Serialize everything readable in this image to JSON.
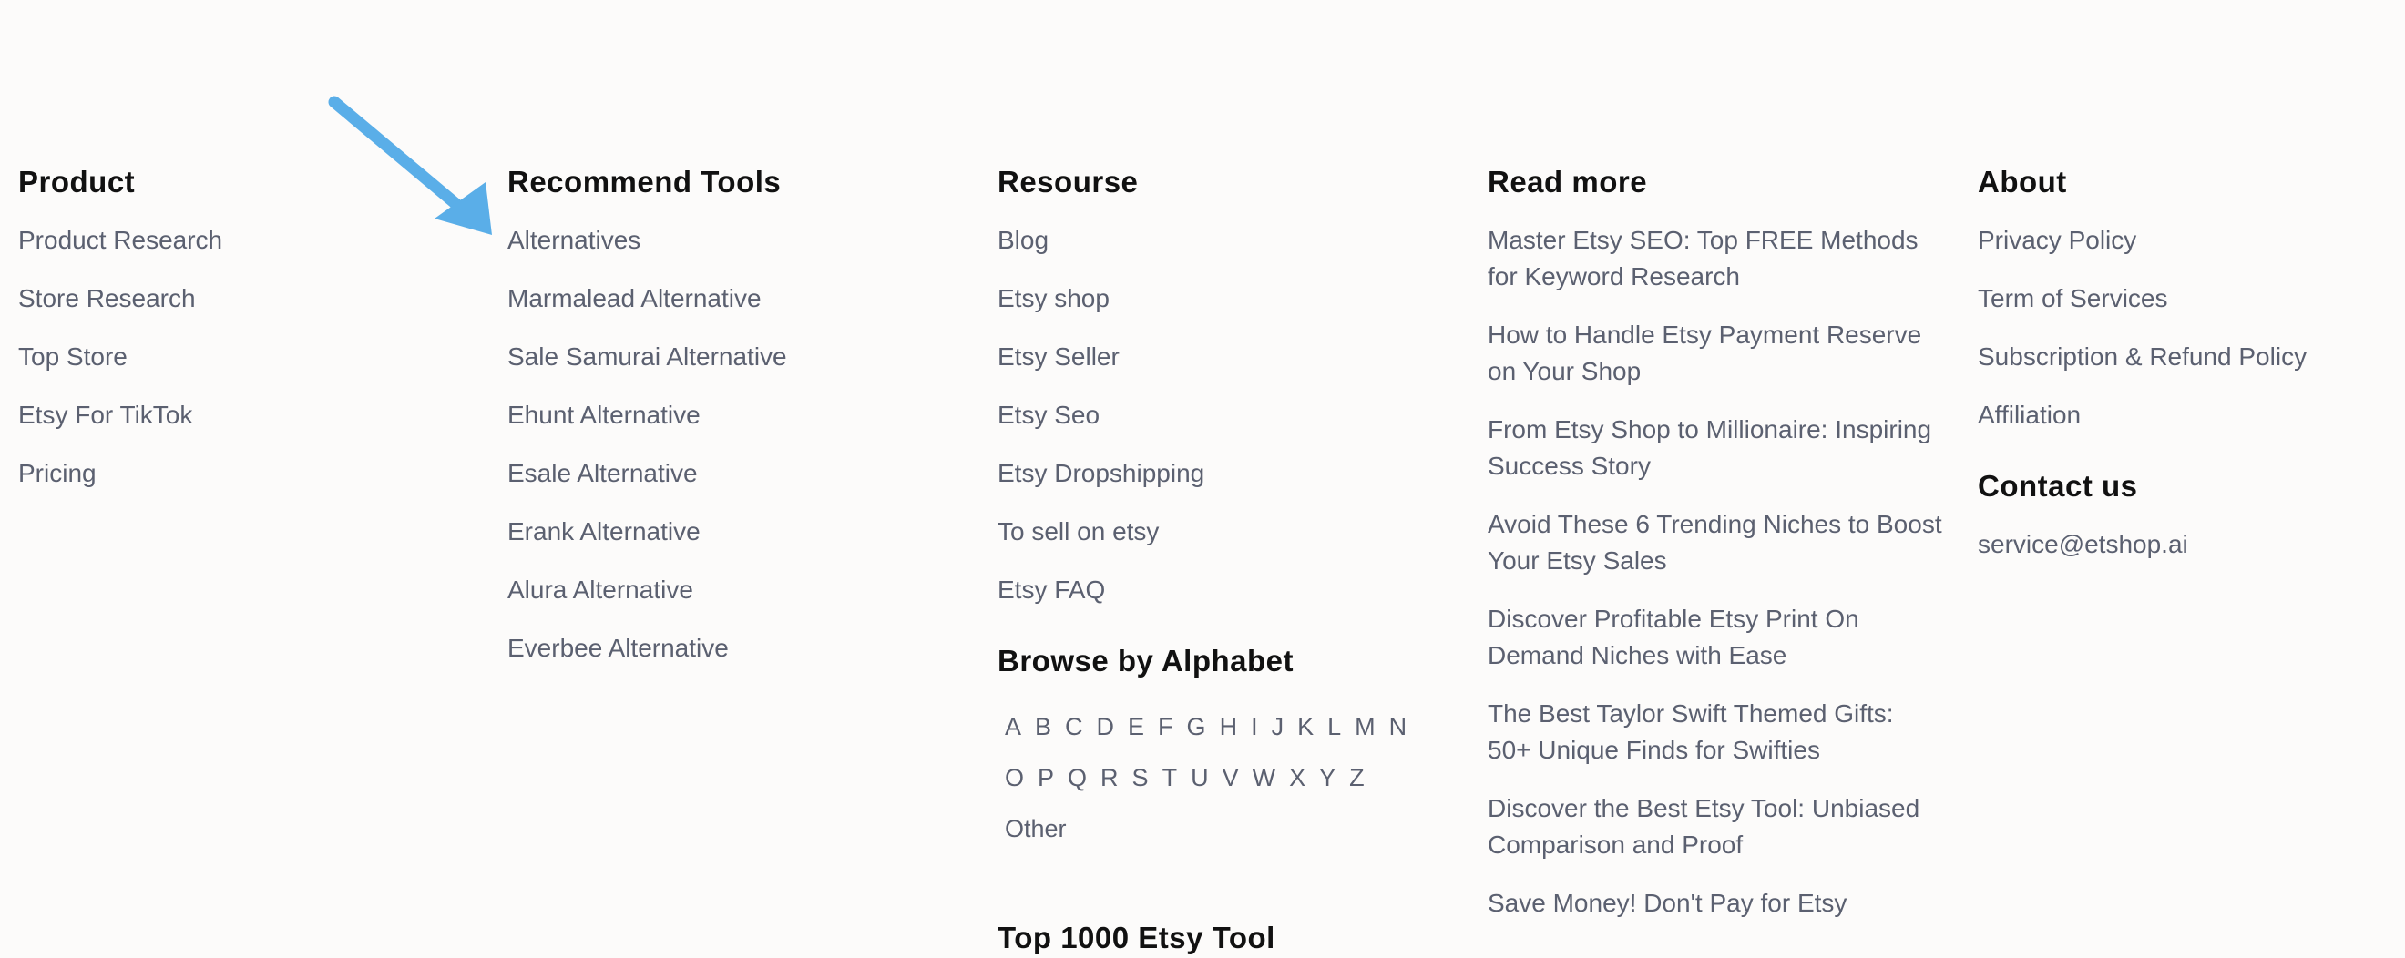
{
  "product": {
    "title": "Product",
    "links": [
      "Product Research",
      "Store Research",
      "Top Store",
      "Etsy For TikTok",
      "Pricing"
    ]
  },
  "tools": {
    "title": "Recommend Tools",
    "links": [
      "Alternatives",
      "Marmalead Alternative",
      "Sale Samurai Alternative",
      "Ehunt Alternative",
      "Esale Alternative",
      "Erank Alternative",
      "Alura Alternative",
      "Everbee Alternative"
    ]
  },
  "resource": {
    "title": "Resourse",
    "links": [
      "Blog",
      "Etsy shop",
      "Etsy Seller",
      "Etsy Seo",
      "Etsy Dropshipping",
      "To sell on etsy",
      "Etsy FAQ"
    ],
    "browse_title": "Browse by Alphabet",
    "letters": [
      "A",
      "B",
      "C",
      "D",
      "E",
      "F",
      "G",
      "H",
      "I",
      "J",
      "K",
      "L",
      "M",
      "N",
      "O",
      "P",
      "Q",
      "R",
      "S",
      "T",
      "U",
      "V",
      "W",
      "X",
      "Y",
      "Z",
      "Other"
    ],
    "next_title": "Top 1000 Etsy Tool"
  },
  "read_more": {
    "title": "Read more",
    "links": [
      "Master Etsy SEO: Top FREE Methods for Keyword Research",
      "How to Handle Etsy Payment Reserve on Your Shop",
      "From Etsy Shop to Millionaire: Inspiring Success Story",
      "Avoid These 6 Trending Niches to Boost Your Etsy Sales",
      "Discover Profitable Etsy Print On Demand Niches with Ease",
      "The Best Taylor Swift Themed Gifts: 50+ Unique Finds for Swifties",
      "Discover the Best Etsy Tool: Unbiased Comparison and Proof",
      "Save Money! Don't Pay for Etsy"
    ]
  },
  "about": {
    "title": "About",
    "links": [
      "Privacy Policy",
      "Term of Services",
      "Subscription & Refund Policy",
      "Affiliation"
    ],
    "contact_title": "Contact us",
    "email": "service@etshop.ai"
  },
  "colors": {
    "background": "#fcfbfa",
    "heading": "#111111",
    "link": "#5b6070",
    "arrow": "#5aaee8"
  }
}
